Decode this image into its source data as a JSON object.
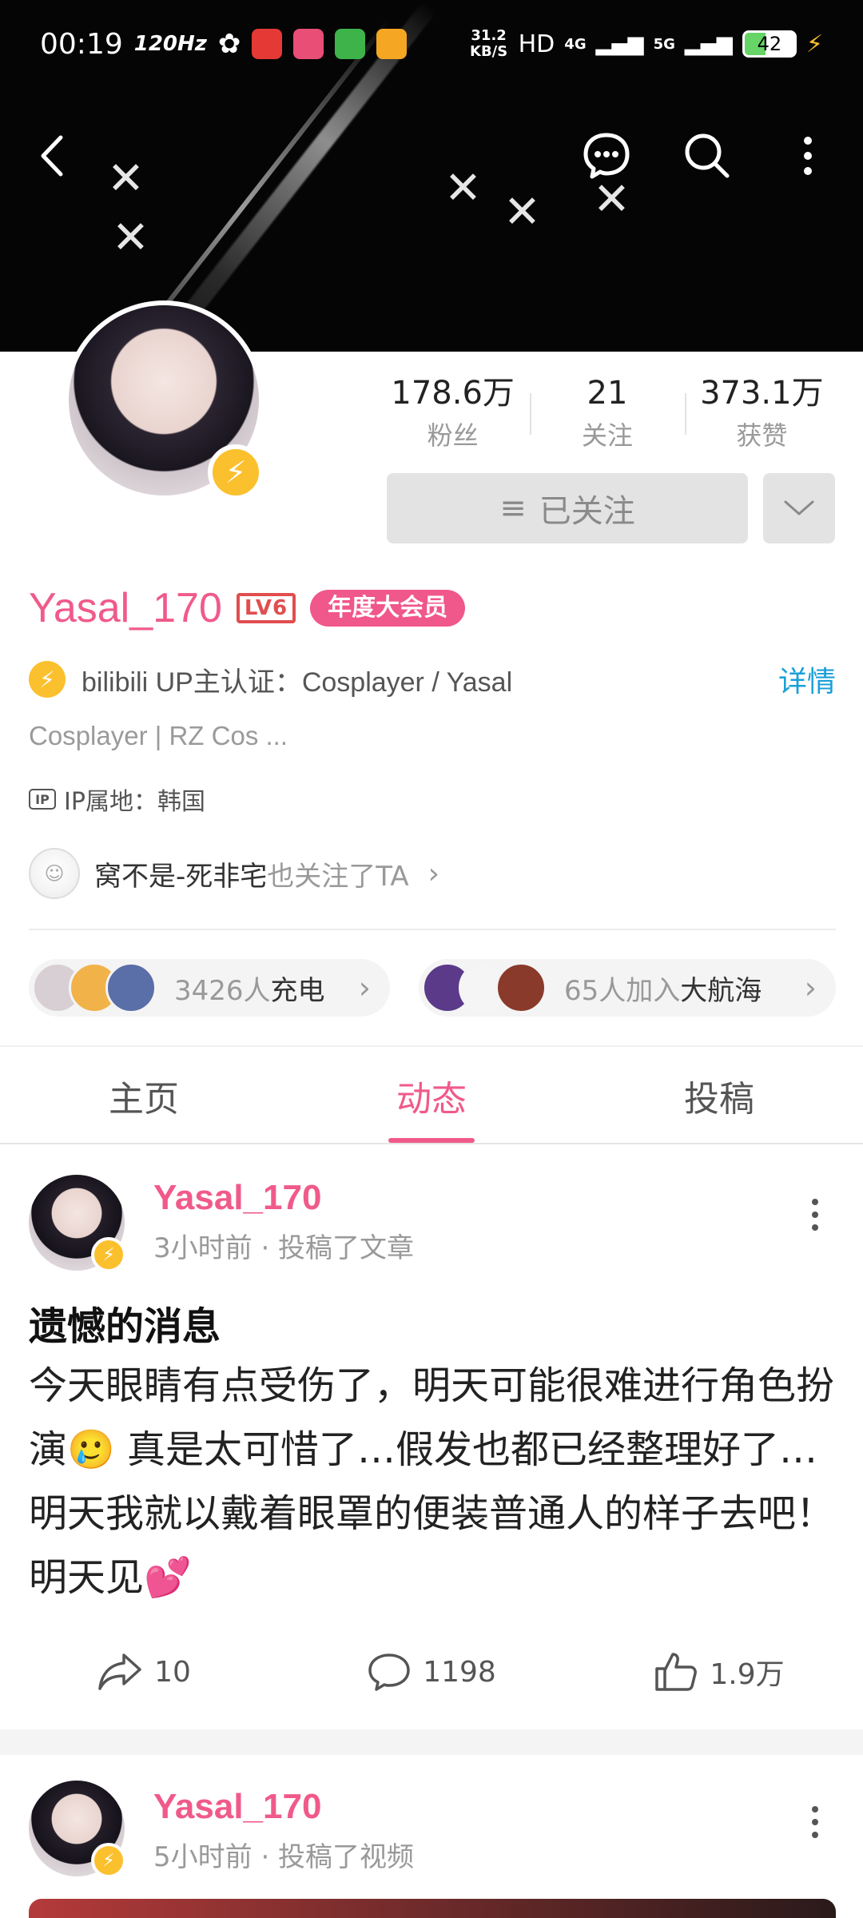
{
  "status_bar": {
    "time": "00:19",
    "refresh": "120Hz",
    "net_speed": "31.2 KB/S",
    "hd": "HD",
    "net1": "4G",
    "net2": "5G",
    "battery": "42"
  },
  "profile": {
    "username": "Yasal_170",
    "level": "LV6",
    "vip_badge": "年度大会员",
    "stats": [
      {
        "value": "178.6万",
        "label": "粉丝"
      },
      {
        "value": "21",
        "label": "关注"
      },
      {
        "value": "373.1万",
        "label": "获赞"
      }
    ],
    "follow_button": "已关注",
    "verify_text": "bilibili UP主认证：Cosplayer / Yasal",
    "detail_link": "详情",
    "bio": "Cosplayer | RZ Cos ...",
    "ip_location": "IP属地：韩国",
    "also_follow_name": "窝不是-死非宅",
    "also_follow_suffix": "也关注了TA",
    "charge_count": "3426人",
    "charge_label": "充电",
    "fleet_count": "65人加入",
    "fleet_label": "大航海"
  },
  "tabs": [
    {
      "label": "主页"
    },
    {
      "label": "动态"
    },
    {
      "label": "投稿"
    }
  ],
  "posts": [
    {
      "name": "Yasal_170",
      "meta": "3小时前 · 投稿了文章",
      "title": "遗憾的消息",
      "body": "今天眼睛有点受伤了，明天可能很难进行角色扮演🥲 真是太可惜了…假发也都已经整理好了…明天我就以戴着眼罩的便装普通人的样子去吧！明天见💕",
      "shares": "10",
      "comments": "1198",
      "likes": "1.9万"
    },
    {
      "name": "Yasal_170",
      "meta": "5小时前 · 投稿了视频"
    }
  ],
  "colors": {
    "accent_pink": "#f05a8a",
    "link_blue": "#1aa0d8",
    "verify_yellow": "#fbc02d"
  }
}
